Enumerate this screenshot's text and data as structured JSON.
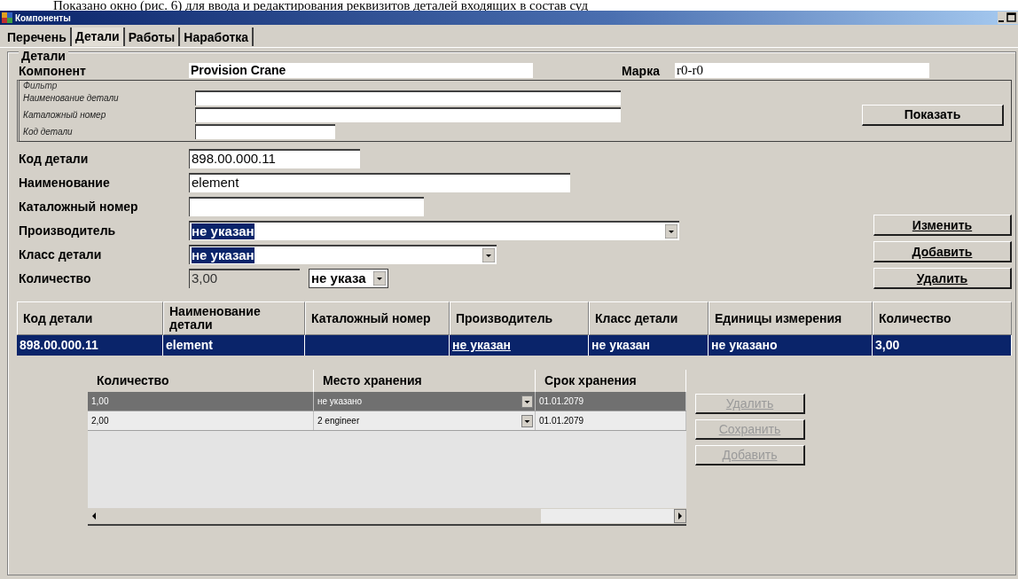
{
  "caption": "Показано окно (рис. 6) для ввода и редактирования реквизитов деталей входящих в состав суд",
  "window": {
    "title": "Компоненты"
  },
  "tabs": [
    {
      "label": "Перечень",
      "selected": false
    },
    {
      "label": "Детали",
      "selected": true
    },
    {
      "label": "Работы",
      "selected": false
    },
    {
      "label": "Наработка",
      "selected": false
    }
  ],
  "group": {
    "title": "Детали"
  },
  "component": {
    "label": "Компонент",
    "value": "Provision Crane"
  },
  "brand": {
    "label": "Марка",
    "value": "r0-r0"
  },
  "filter": {
    "title": "Фильтр",
    "fields": [
      {
        "label": "Наименование детали"
      },
      {
        "label": "Каталожный номер"
      },
      {
        "label": "Код детали"
      }
    ]
  },
  "show_button": "Показать",
  "form": [
    {
      "kind": "text",
      "label": "Код детали",
      "value": "898.00.000.11"
    },
    {
      "kind": "text",
      "label": "Наименование",
      "value": "element"
    },
    {
      "kind": "text",
      "label": "Каталожный номер"
    },
    {
      "kind": "combo",
      "label": "Производитель",
      "value": "не указан",
      "highlighted": true
    },
    {
      "kind": "combo",
      "label": "Класс детали",
      "value": "не указан",
      "highlighted": true
    },
    {
      "kind": "quantity",
      "label": "Количество",
      "value": "3,00",
      "disabled": true,
      "unit": "не указа"
    }
  ],
  "actions": [
    "Изменить",
    "Добавить",
    "Удалить"
  ],
  "table": {
    "columns": [
      "Код детали",
      "Наименование детали",
      "Каталожный номер",
      "Производитель",
      "Класс детали",
      "Единицы измерения",
      "Количество"
    ],
    "rows": [
      {
        "selected": true,
        "cells": [
          {
            "text": "898.00.000.11",
            "underlined": false
          },
          {
            "text": "element",
            "underlined": false
          },
          null,
          {
            "text": "не указан",
            "underlined": true
          },
          {
            "text": "не указан",
            "underlined": false
          },
          {
            "text": "не указано",
            "underlined": false
          },
          {
            "text": "3,00",
            "underlined": false
          }
        ]
      }
    ]
  },
  "storage": {
    "columns": [
      "Количество",
      "Место хранения",
      "Срок хранения"
    ],
    "rows": [
      {
        "selected": true,
        "cells": [
          "1,00",
          "не указано",
          "01.01.2079"
        ]
      },
      {
        "selected": false,
        "cells": [
          "2,00",
          "2 engineer",
          "01.01.2079"
        ]
      }
    ]
  },
  "storage_actions": [
    {
      "label": "Удалить",
      "disabled": true
    },
    {
      "label": "Сохранить",
      "disabled": true
    },
    {
      "label": "Добавить",
      "disabled": true
    }
  ]
}
